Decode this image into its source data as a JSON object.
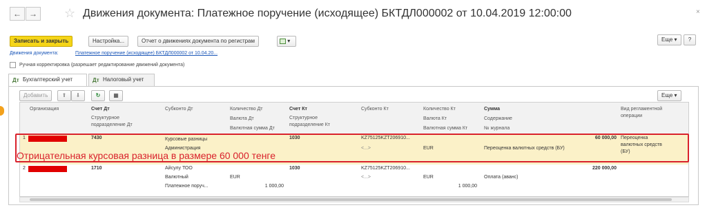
{
  "window": {
    "title": "Движения документа: Платежное поручение (исходящее) БКТДЛ000002 от 10.04.2019 12:00:00",
    "back_icon": "←",
    "forward_icon": "→",
    "star_icon": "☆",
    "close_icon": "×"
  },
  "toolbar": {
    "save_close": "Записать и закрыть",
    "settings": "Настройка...",
    "report": "Отчет о движениях документа по регистрам",
    "more": "Еще ▾",
    "help": "?"
  },
  "breadcrumb": {
    "label": "Движения документа:",
    "link": "Платежное поручение (исходящее) БКТДЛ000002 от 10.04.20..."
  },
  "manual": {
    "label": "Ручная корректировка (разрешает редактирование движений документа)"
  },
  "tabs": [
    {
      "label": "Бухгалтерский учет",
      "icon": "Дт Кт"
    },
    {
      "label": "Налоговый учет",
      "icon": "Дт Кт"
    }
  ],
  "table_toolbar": {
    "add": "Добавить",
    "more": "Еще ▾"
  },
  "columns": {
    "org": "Организация",
    "dt": [
      "Счет Дт",
      "Структурное",
      "подразделение Дт"
    ],
    "sub_dt": "Субконто Дт",
    "qty_dt": [
      "Количество Дт",
      "Валюта Дт",
      "Валютная сумма Дт"
    ],
    "kt": [
      "Счет Кт",
      "Структурное",
      "подразделение Кт"
    ],
    "sub_kt": "Субконто Кт",
    "qty_kt": [
      "Количество Кт",
      "Валюта Кт",
      "Валютная сумма Кт"
    ],
    "sum": [
      "Сумма",
      "Содержание",
      "№ журнала"
    ],
    "op": [
      "Вид регламентной",
      "операции"
    ]
  },
  "rows": [
    {
      "n": "1",
      "dt": "7430",
      "sub_dt": [
        "Курсовые разницы",
        "Администрация"
      ],
      "kt": "1030",
      "sub_kt": [
        "KZ75125KZT206910...",
        "<...>"
      ],
      "cur_kt": "EUR",
      "sum": "60 000,00",
      "content": "Переоценка валютных средств (БУ)",
      "op": [
        "Переоценка",
        "валютных средств",
        "(БУ)"
      ]
    },
    {
      "n": "2",
      "dt": "1710",
      "sub_dt": [
        "Айсулу ТОО",
        "Валютный",
        "Платежное поруч..."
      ],
      "cur_dt": "EUR",
      "amount_dt": "1 000,00",
      "kt": "1030",
      "sub_kt": [
        "KZ75125KZT206910...",
        "<...>"
      ],
      "cur_kt": "EUR",
      "amount_kt": "1 000,00",
      "sum": "220 000,00",
      "content": "Оплата (аванс)"
    }
  ],
  "annotation": "Отрицательная курсовая разница в размере 60 000 тенге",
  "colors": {
    "primary_button": "#f5d518",
    "highlight": "#d9212b",
    "selected_row": "#fbf1c8",
    "link": "#1a56b8"
  }
}
